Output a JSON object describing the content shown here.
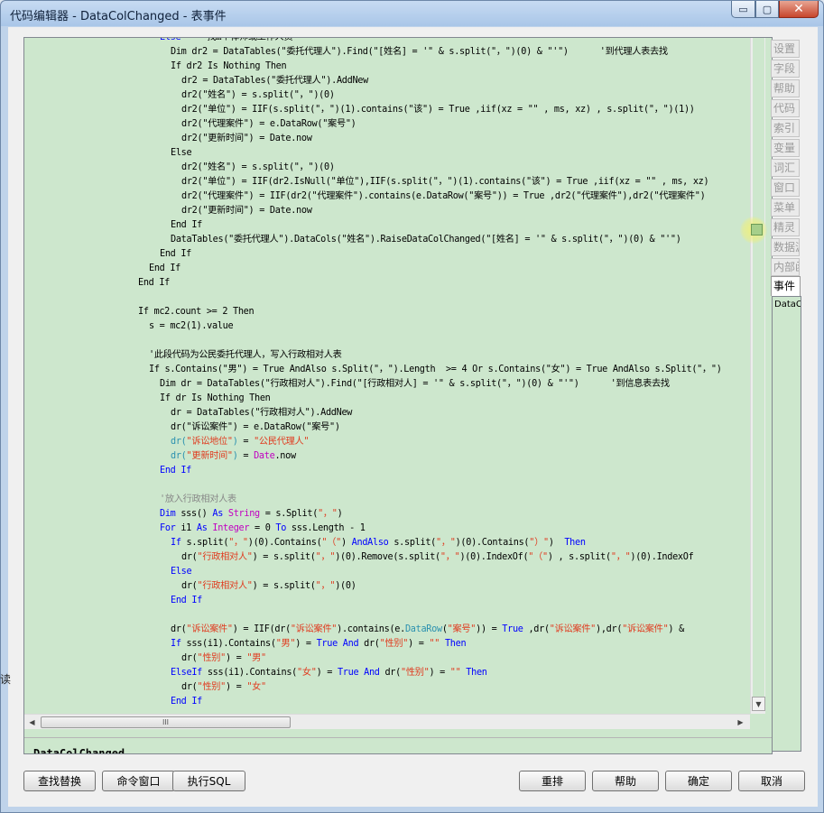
{
  "window": {
    "title": "代码编辑器 - DataColChanged - 表事件",
    "min_glyph": "▭",
    "max_glyph": "▢",
    "close_glyph": "✕"
  },
  "editor": {
    "code_lines": [
      {
        "indent": 48,
        "tokens": [
          {
            "c": "kw",
            "t": "Else"
          },
          {
            "c": "",
            "t": "    '找…个律师或工作人员"
          }
        ]
      },
      {
        "indent": 52,
        "tokens": [
          {
            "c": "",
            "t": "Dim dr2 = DataTables(\"委托代理人\").Find(\"[姓名] = '\" & s.split(\"，\")(0) & \"'\")      '到代理人表去找"
          }
        ]
      },
      {
        "indent": 52,
        "tokens": [
          {
            "c": "",
            "t": "If dr2 Is Nothing Then"
          }
        ]
      },
      {
        "indent": 56,
        "tokens": [
          {
            "c": "",
            "t": "dr2 = DataTables(\"委托代理人\").AddNew"
          }
        ]
      },
      {
        "indent": 56,
        "tokens": [
          {
            "c": "",
            "t": "dr2(\"姓名\") = s.split(\"，\")(0)"
          }
        ]
      },
      {
        "indent": 56,
        "tokens": [
          {
            "c": "",
            "t": "dr2(\"单位\") = IIF(s.split(\"，\")(1).contains(\"该\") = True ,iif(xz = \"\" , ms, xz) , s.split(\"，\")(1))"
          }
        ]
      },
      {
        "indent": 56,
        "tokens": [
          {
            "c": "",
            "t": "dr2(\"代理案件\") = e.DataRow(\"案号\")"
          }
        ]
      },
      {
        "indent": 56,
        "tokens": [
          {
            "c": "",
            "t": "dr2(\"更新时间\") = Date.now"
          }
        ]
      },
      {
        "indent": 52,
        "tokens": [
          {
            "c": "",
            "t": "Else"
          }
        ]
      },
      {
        "indent": 56,
        "tokens": [
          {
            "c": "",
            "t": "dr2(\"姓名\") = s.split(\"，\")(0)"
          }
        ]
      },
      {
        "indent": 56,
        "tokens": [
          {
            "c": "",
            "t": "dr2(\"单位\") = IIF(dr2.IsNull(\"单位\"),IIF(s.split(\"，\")(1).contains(\"该\") = True ,iif(xz = \"\" , ms, xz)"
          }
        ]
      },
      {
        "indent": 56,
        "tokens": [
          {
            "c": "",
            "t": "dr2(\"代理案件\") = IIF(dr2(\"代理案件\").contains(e.DataRow(\"案号\")) = True ,dr2(\"代理案件\"),dr2(\"代理案件\")"
          }
        ]
      },
      {
        "indent": 56,
        "tokens": [
          {
            "c": "",
            "t": "dr2(\"更新时间\") = Date.now"
          }
        ]
      },
      {
        "indent": 52,
        "tokens": [
          {
            "c": "",
            "t": "End If"
          }
        ]
      },
      {
        "indent": 52,
        "tokens": [
          {
            "c": "",
            "t": "DataTables(\"委托代理人\").DataCols(\"姓名\").RaiseDataColChanged(\"[姓名] = '\" & s.split(\"，\")(0) & \"'\")"
          }
        ]
      },
      {
        "indent": 48,
        "tokens": [
          {
            "c": "",
            "t": "End If"
          }
        ]
      },
      {
        "indent": 44,
        "tokens": [
          {
            "c": "",
            "t": "End If"
          }
        ]
      },
      {
        "indent": 40,
        "tokens": [
          {
            "c": "",
            "t": "End If"
          }
        ]
      },
      {
        "indent": 0,
        "tokens": [
          {
            "c": "",
            "t": ""
          }
        ]
      },
      {
        "indent": 40,
        "tokens": [
          {
            "c": "",
            "t": "If mc2.count >= 2 Then"
          }
        ]
      },
      {
        "indent": 44,
        "tokens": [
          {
            "c": "",
            "t": "s = mc2(1).value"
          }
        ]
      },
      {
        "indent": 0,
        "tokens": [
          {
            "c": "",
            "t": ""
          }
        ]
      },
      {
        "indent": 44,
        "tokens": [
          {
            "c": "",
            "t": "'此段代码为公民委托代理人，写入行政相对人表"
          }
        ]
      },
      {
        "indent": 44,
        "tokens": [
          {
            "c": "",
            "t": "If s.Contains(\"男\") = True AndAlso s.Split(\"，\").Length  >= 4 Or s.Contains(\"女\") = True AndAlso s.Split(\"，\")"
          }
        ]
      },
      {
        "indent": 48,
        "tokens": [
          {
            "c": "",
            "t": "Dim dr = DataTables(\"行政相对人\").Find(\"[行政相对人] = '\" & s.split(\"，\")(0) & \"'\")      '到信息表去找"
          }
        ]
      },
      {
        "indent": 48,
        "tokens": [
          {
            "c": "",
            "t": "If dr Is Nothing Then"
          }
        ]
      },
      {
        "indent": 52,
        "tokens": [
          {
            "c": "",
            "t": "dr = DataTables(\"行政相对人\").AddNew"
          }
        ]
      },
      {
        "indent": 52,
        "tokens": [
          {
            "c": "",
            "t": "dr(\"诉讼案件\") = e.DataRow(\"案号\")"
          }
        ]
      },
      {
        "indent": 52,
        "tokens": [
          {
            "c": "ty",
            "t": "dr("
          },
          {
            "c": "st",
            "t": "\"诉讼地位\""
          },
          {
            "c": "ty",
            "t": ")"
          },
          {
            "c": "",
            "t": " = "
          },
          {
            "c": "st",
            "t": "\"公民代理人\""
          }
        ]
      },
      {
        "indent": 52,
        "tokens": [
          {
            "c": "ty",
            "t": "dr("
          },
          {
            "c": "st",
            "t": "\"更新时间\""
          },
          {
            "c": "ty",
            "t": ")"
          },
          {
            "c": "",
            "t": " = "
          },
          {
            "c": "pr",
            "t": "Date"
          },
          {
            "c": "",
            "t": ".now"
          }
        ]
      },
      {
        "indent": 48,
        "tokens": [
          {
            "c": "kw",
            "t": "End If"
          }
        ]
      },
      {
        "indent": 0,
        "tokens": [
          {
            "c": "",
            "t": ""
          }
        ]
      },
      {
        "indent": 48,
        "tokens": [
          {
            "c": "cm",
            "t": "'放入行政相对人表"
          }
        ]
      },
      {
        "indent": 48,
        "tokens": [
          {
            "c": "kw",
            "t": "Dim"
          },
          {
            "c": "",
            "t": " sss() "
          },
          {
            "c": "kw",
            "t": "As"
          },
          {
            "c": "",
            "t": " "
          },
          {
            "c": "pr",
            "t": "String"
          },
          {
            "c": "",
            "t": " = s.Split("
          },
          {
            "c": "st",
            "t": "\"，\""
          },
          {
            "c": "",
            "t": ")"
          }
        ]
      },
      {
        "indent": 48,
        "tokens": [
          {
            "c": "kw",
            "t": "For"
          },
          {
            "c": "",
            "t": " i1 "
          },
          {
            "c": "kw",
            "t": "As"
          },
          {
            "c": "",
            "t": " "
          },
          {
            "c": "pr",
            "t": "Integer"
          },
          {
            "c": "",
            "t": " = 0 "
          },
          {
            "c": "kw",
            "t": "To"
          },
          {
            "c": "",
            "t": " sss.Length - 1"
          }
        ]
      },
      {
        "indent": 52,
        "tokens": [
          {
            "c": "kw",
            "t": "If"
          },
          {
            "c": "",
            "t": " s.split("
          },
          {
            "c": "st",
            "t": "\"，\""
          },
          {
            "c": "",
            "t": ")(0).Contains("
          },
          {
            "c": "st",
            "t": "\"（\""
          },
          {
            "c": "",
            "t": ") "
          },
          {
            "c": "kw",
            "t": "AndAlso"
          },
          {
            "c": "",
            "t": " s.split("
          },
          {
            "c": "st",
            "t": "\"，\""
          },
          {
            "c": "",
            "t": ")(0).Contains("
          },
          {
            "c": "st",
            "t": "\"）\""
          },
          {
            "c": "",
            "t": ")  "
          },
          {
            "c": "kw",
            "t": "Then"
          }
        ]
      },
      {
        "indent": 56,
        "tokens": [
          {
            "c": "",
            "t": "dr("
          },
          {
            "c": "st",
            "t": "\"行政相对人\""
          },
          {
            "c": "",
            "t": ") = s.split("
          },
          {
            "c": "st",
            "t": "\"，\""
          },
          {
            "c": "",
            "t": ")(0).Remove(s.split("
          },
          {
            "c": "st",
            "t": "\"，\""
          },
          {
            "c": "",
            "t": ")(0).IndexOf("
          },
          {
            "c": "st",
            "t": "\"（\""
          },
          {
            "c": "",
            "t": ") , s.split("
          },
          {
            "c": "st",
            "t": "\"，\""
          },
          {
            "c": "",
            "t": ")(0).IndexOf"
          }
        ]
      },
      {
        "indent": 52,
        "tokens": [
          {
            "c": "kw",
            "t": "Else"
          }
        ]
      },
      {
        "indent": 56,
        "tokens": [
          {
            "c": "",
            "t": "dr("
          },
          {
            "c": "st",
            "t": "\"行政相对人\""
          },
          {
            "c": "",
            "t": ") = s.split("
          },
          {
            "c": "st",
            "t": "\"，\""
          },
          {
            "c": "",
            "t": ")(0)"
          }
        ]
      },
      {
        "indent": 52,
        "tokens": [
          {
            "c": "kw",
            "t": "End If"
          }
        ]
      },
      {
        "indent": 0,
        "tokens": [
          {
            "c": "",
            "t": ""
          }
        ]
      },
      {
        "indent": 52,
        "tokens": [
          {
            "c": "",
            "t": "dr("
          },
          {
            "c": "st",
            "t": "\"诉讼案件\""
          },
          {
            "c": "",
            "t": ") = IIF(dr("
          },
          {
            "c": "st",
            "t": "\"诉讼案件\""
          },
          {
            "c": "",
            "t": ").contains(e."
          },
          {
            "c": "ty",
            "t": "DataRow"
          },
          {
            "c": "",
            "t": "("
          },
          {
            "c": "st",
            "t": "\"案号\""
          },
          {
            "c": "",
            "t": ")) = "
          },
          {
            "c": "kw",
            "t": "True"
          },
          {
            "c": "",
            "t": " ,dr("
          },
          {
            "c": "st",
            "t": "\"诉讼案件\""
          },
          {
            "c": "",
            "t": "),dr("
          },
          {
            "c": "st",
            "t": "\"诉讼案件\""
          },
          {
            "c": "",
            "t": ") &"
          }
        ]
      },
      {
        "indent": 52,
        "tokens": [
          {
            "c": "kw",
            "t": "If"
          },
          {
            "c": "",
            "t": " sss(i1).Contains("
          },
          {
            "c": "st",
            "t": "\"男\""
          },
          {
            "c": "",
            "t": ") = "
          },
          {
            "c": "kw",
            "t": "True"
          },
          {
            "c": "",
            "t": " "
          },
          {
            "c": "kw",
            "t": "And"
          },
          {
            "c": "",
            "t": " dr("
          },
          {
            "c": "st",
            "t": "\"性别\""
          },
          {
            "c": "",
            "t": ") = "
          },
          {
            "c": "st",
            "t": "\"\""
          },
          {
            "c": "",
            "t": " "
          },
          {
            "c": "kw",
            "t": "Then"
          }
        ]
      },
      {
        "indent": 56,
        "tokens": [
          {
            "c": "",
            "t": "dr("
          },
          {
            "c": "st",
            "t": "\"性别\""
          },
          {
            "c": "",
            "t": ") = "
          },
          {
            "c": "st",
            "t": "\"男\""
          }
        ]
      },
      {
        "indent": 52,
        "tokens": [
          {
            "c": "kw",
            "t": "ElseIf"
          },
          {
            "c": "",
            "t": " sss(i1).Contains("
          },
          {
            "c": "st",
            "t": "\"女\""
          },
          {
            "c": "",
            "t": ") = "
          },
          {
            "c": "kw",
            "t": "True"
          },
          {
            "c": "",
            "t": " "
          },
          {
            "c": "kw",
            "t": "And"
          },
          {
            "c": "",
            "t": " dr("
          },
          {
            "c": "st",
            "t": "\"性别\""
          },
          {
            "c": "",
            "t": ") = "
          },
          {
            "c": "st",
            "t": "\"\""
          },
          {
            "c": "",
            "t": " "
          },
          {
            "c": "kw",
            "t": "Then"
          }
        ]
      },
      {
        "indent": 56,
        "tokens": [
          {
            "c": "",
            "t": "dr("
          },
          {
            "c": "st",
            "t": "\"性别\""
          },
          {
            "c": "",
            "t": ") = "
          },
          {
            "c": "st",
            "t": "\"女\""
          }
        ]
      },
      {
        "indent": 52,
        "tokens": [
          {
            "c": "kw",
            "t": "End If"
          }
        ]
      }
    ],
    "hscroll_grip": "III",
    "event_name": "DataColChanged"
  },
  "side_tabs": [
    "设置",
    "字段",
    "帮助",
    "代码",
    "索引",
    "变量",
    "词汇",
    "窗口",
    "菜单",
    "精灵",
    "数据源",
    "内部函"
  ],
  "active_tab": "事件",
  "side_list_item": "DataColChanged",
  "buttons": {
    "find_replace": "查找替换",
    "command_window": "命令窗口",
    "exec_sql": "执行SQL",
    "reformat": "重排",
    "help": "帮助",
    "ok": "确定",
    "cancel": "取消"
  },
  "left_edge_char": "读"
}
